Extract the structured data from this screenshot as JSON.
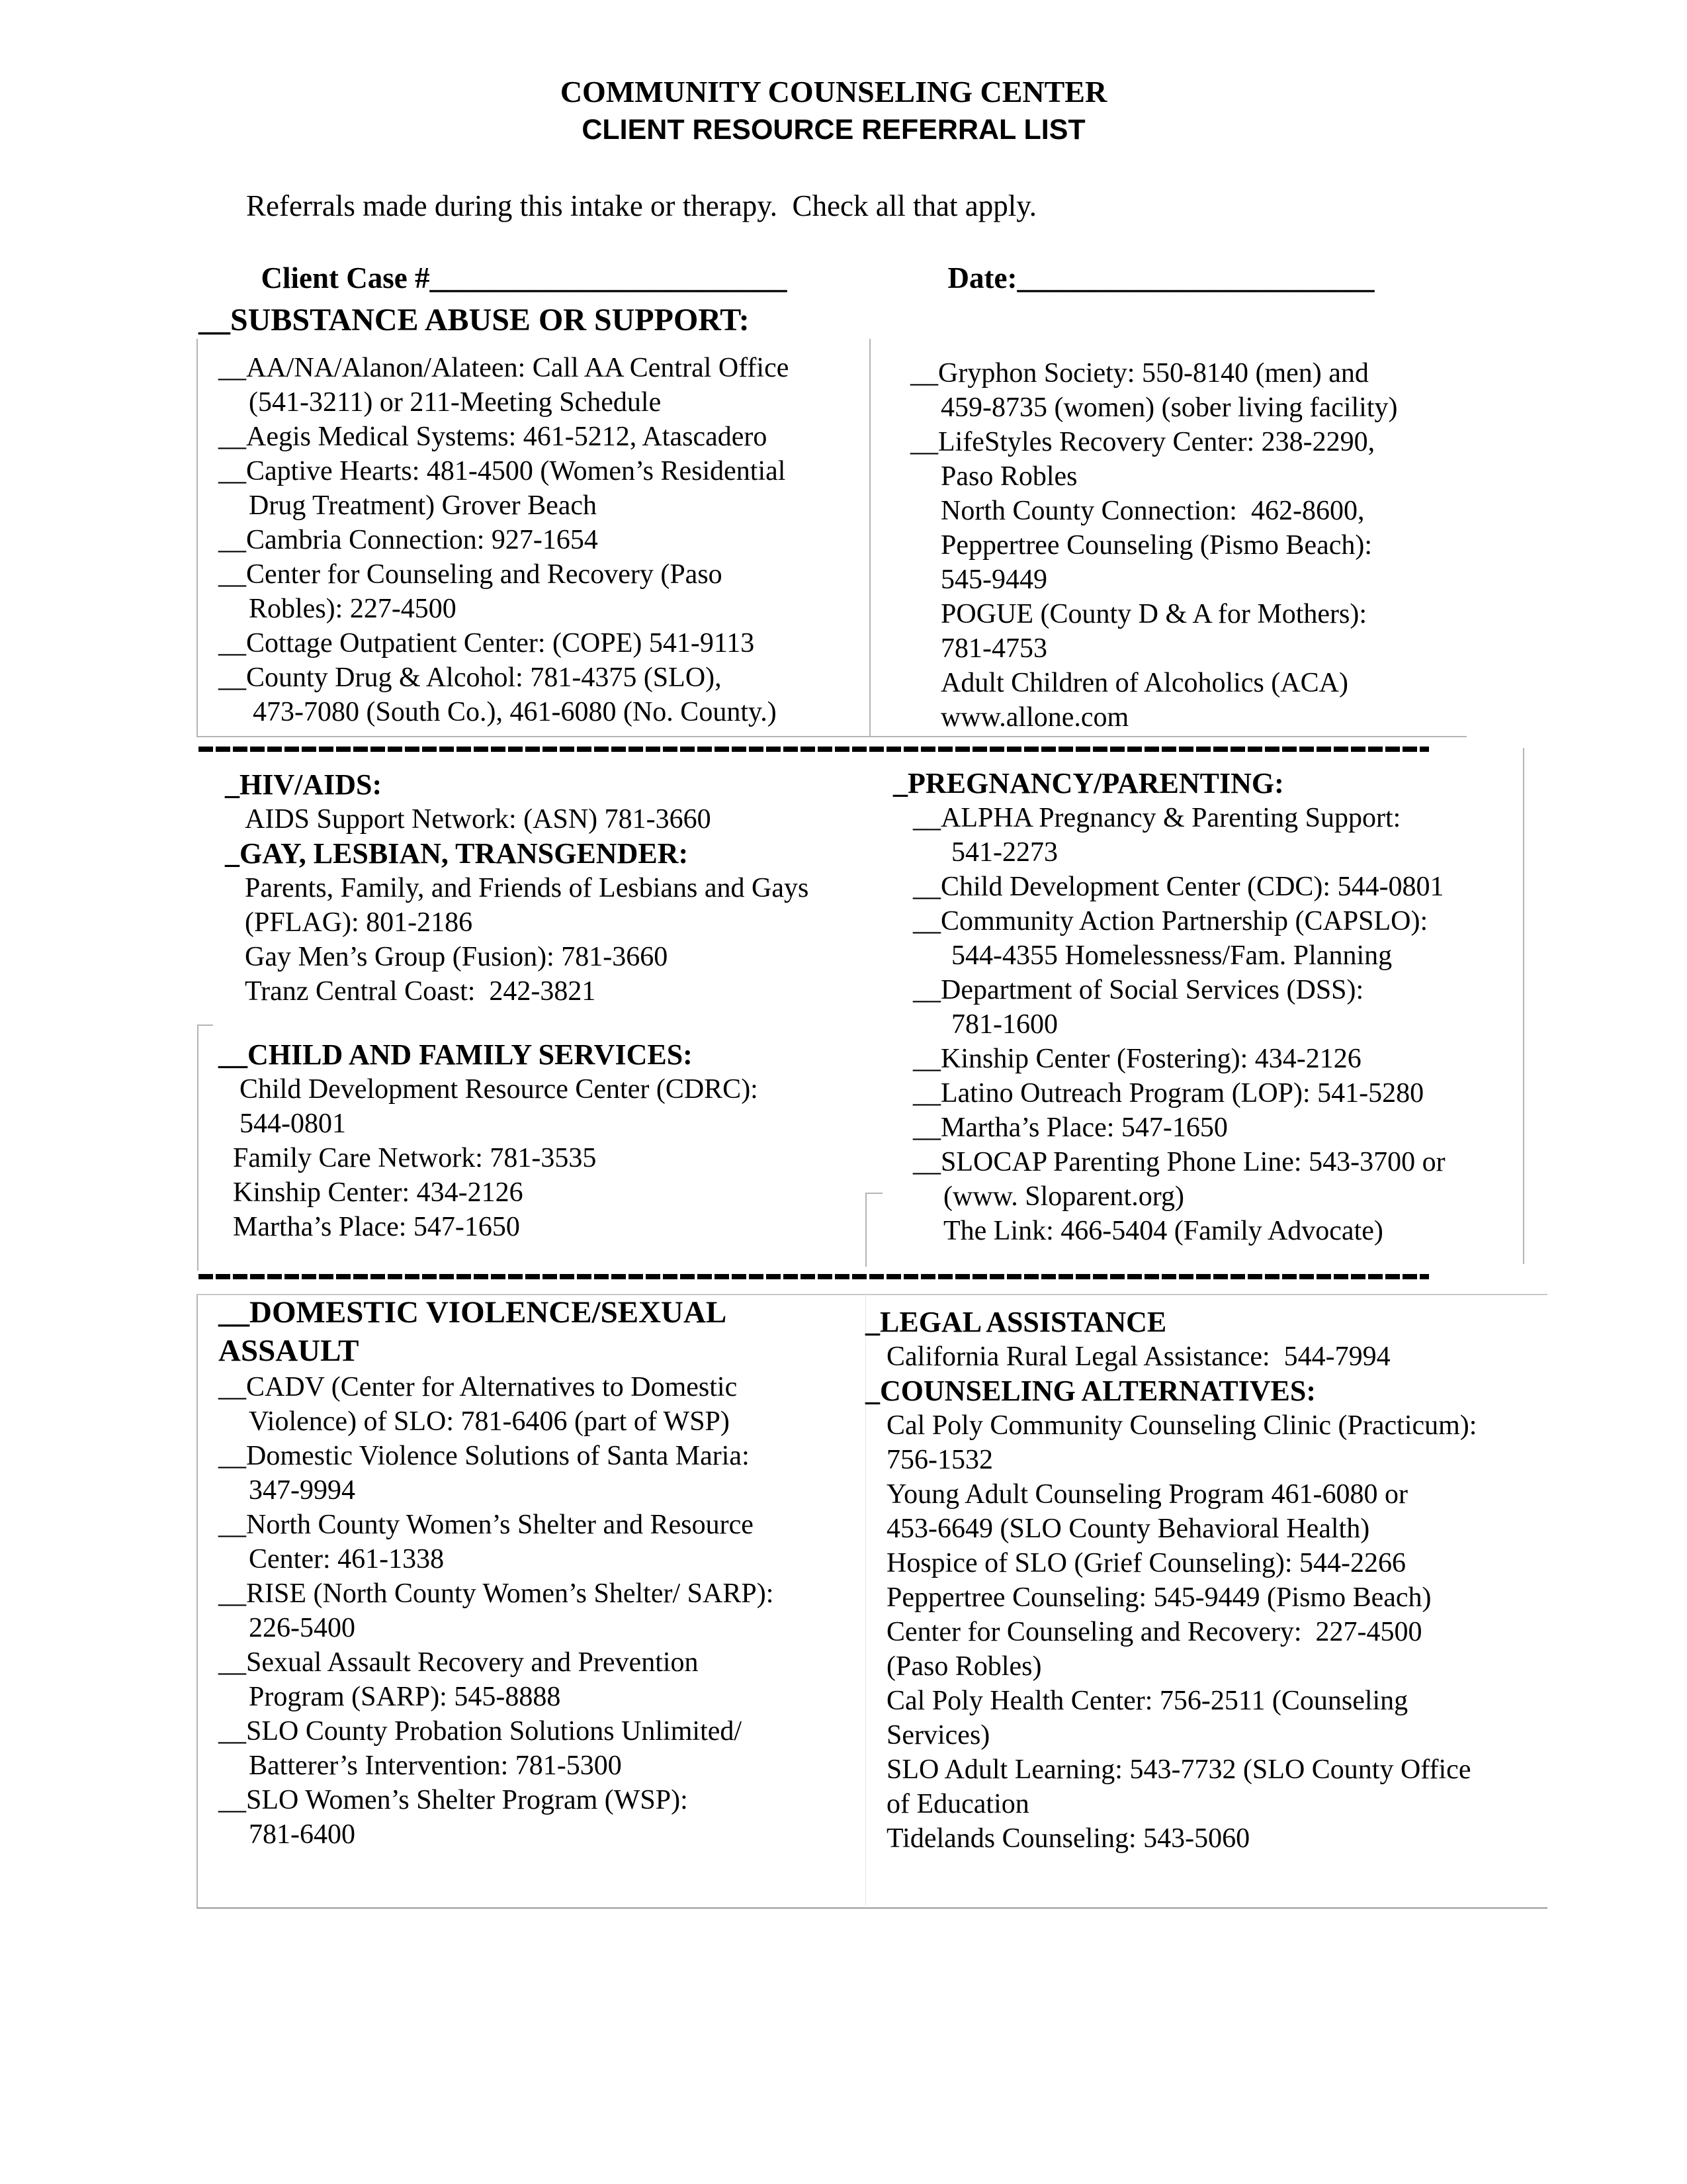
{
  "header": {
    "title_line1": "COMMUNITY COUNSELING CENTER",
    "title_line2": "CLIENT RESOURCE REFERRAL LIST"
  },
  "intro": {
    "instruction": "Referrals made during this intake or therapy.  Check all that apply.",
    "case_label": "Client Case #",
    "case_blank": "________________________",
    "date_label": "Date:",
    "date_blank": "________________________"
  },
  "sections": {
    "substance": {
      "heading": "__SUBSTANCE ABUSE OR SUPPORT:",
      "left_lines": [
        "__AA/NA/Alanon/Alateen: Call AA Central Office",
        "(541-3211) or 211-Meeting Schedule",
        "__Aegis Medical Systems: 461-5212, Atascadero",
        "__Captive Hearts: 481-4500 (Women’s Residential",
        "Drug Treatment) Grover Beach",
        "__Cambria Connection: 927-1654",
        "__Center for Counseling and Recovery (Paso",
        "Robles): 227-4500",
        "__Cottage Outpatient Center: (COPE) 541-9113",
        "__County Drug & Alcohol: 781-4375 (SLO),",
        "473-7080 (South Co.), 461-6080 (No. County.)"
      ],
      "right_lines": [
        "__Gryphon Society: 550-8140 (men) and",
        "459-8735 (women) (sober living facility)",
        "__LifeStyles Recovery Center: 238-2290,",
        "Paso Robles",
        "North County Connection:  462-8600,",
        "Peppertree Counseling (Pismo Beach):",
        "545-9449",
        "POGUE (County D & A for Mothers):",
        "781-4753",
        "Adult Children of Alcoholics (ACA)",
        "www.allone.com"
      ]
    },
    "hiv": {
      "heading": "_HIV/AIDS:",
      "lines": [
        "AIDS Support Network: (ASN) 781-3660"
      ]
    },
    "glt": {
      "heading": "_GAY, LESBIAN, TRANSGENDER:",
      "lines": [
        "Parents, Family, and Friends of Lesbians and Gays",
        "(PFLAG): 801-2186",
        "Gay Men’s Group (Fusion): 781-3660",
        "Tranz Central Coast:  242-3821"
      ]
    },
    "child_family": {
      "heading": "__CHILD AND FAMILY SERVICES:",
      "lines": [
        "Child Development Resource Center (CDRC):",
        "544-0801",
        "Family Care Network: 781-3535",
        "Kinship Center: 434-2126",
        "Martha’s Place: 547-1650"
      ]
    },
    "pregnancy": {
      "heading": "_PREGNANCY/PARENTING:",
      "lines": [
        "__ALPHA Pregnancy & Parenting Support:",
        "541-2273",
        "__Child Development Center (CDC): 544-0801",
        "__Community Action Partnership (CAPSLO):",
        "544-4355 Homelessness/Fam. Planning",
        "__Department of Social Services (DSS):",
        "781-1600",
        "__Kinship Center (Fostering): 434-2126",
        "__Latino Outreach Program (LOP): 541-5280",
        "__Martha’s Place: 547-1650",
        "__SLOCAP Parenting Phone Line: 543-3700 or",
        "(www. Sloparent.org)",
        "The Link: 466-5404 (Family Advocate)"
      ]
    },
    "domestic": {
      "heading_line1": "__DOMESTIC VIOLENCE/SEXUAL",
      "heading_line2": "ASSAULT",
      "lines": [
        "__CADV (Center for Alternatives to Domestic",
        "Violence) of SLO: 781-6406 (part of WSP)",
        "__Domestic Violence Solutions of Santa Maria:",
        "347-9994",
        "__North County Women’s Shelter and Resource",
        "Center: 461-1338",
        "__RISE (North County Women’s Shelter/ SARP):",
        "226-5400",
        "__Sexual Assault Recovery and Prevention",
        "Program (SARP): 545-8888",
        "__SLO County Probation Solutions Unlimited/",
        "Batterer’s Intervention: 781-5300",
        "__SLO Women’s Shelter Program (WSP):",
        "781-6400"
      ]
    },
    "legal": {
      "heading": "_LEGAL ASSISTANCE",
      "lines": [
        "California Rural Legal Assistance:  544-7994"
      ]
    },
    "counseling": {
      "heading": "_COUNSELING ALTERNATIVES:",
      "lines": [
        "Cal Poly Community Counseling Clinic (Practicum):",
        "756-1532",
        "Young Adult Counseling Program 461-6080 or",
        "453-6649 (SLO County Behavioral Health)",
        "Hospice of SLO (Grief Counseling): 544-2266",
        "Peppertree Counseling: 545-9449 (Pismo Beach)",
        "Center for Counseling and Recovery:  227-4500",
        "(Paso Robles)",
        "Cal Poly Health Center: 756-2511 (Counseling",
        "Services)",
        "SLO Adult Learning: 543-7732 (SLO County Office",
        "of Education",
        "Tidelands Counseling: 543-5060"
      ]
    }
  }
}
